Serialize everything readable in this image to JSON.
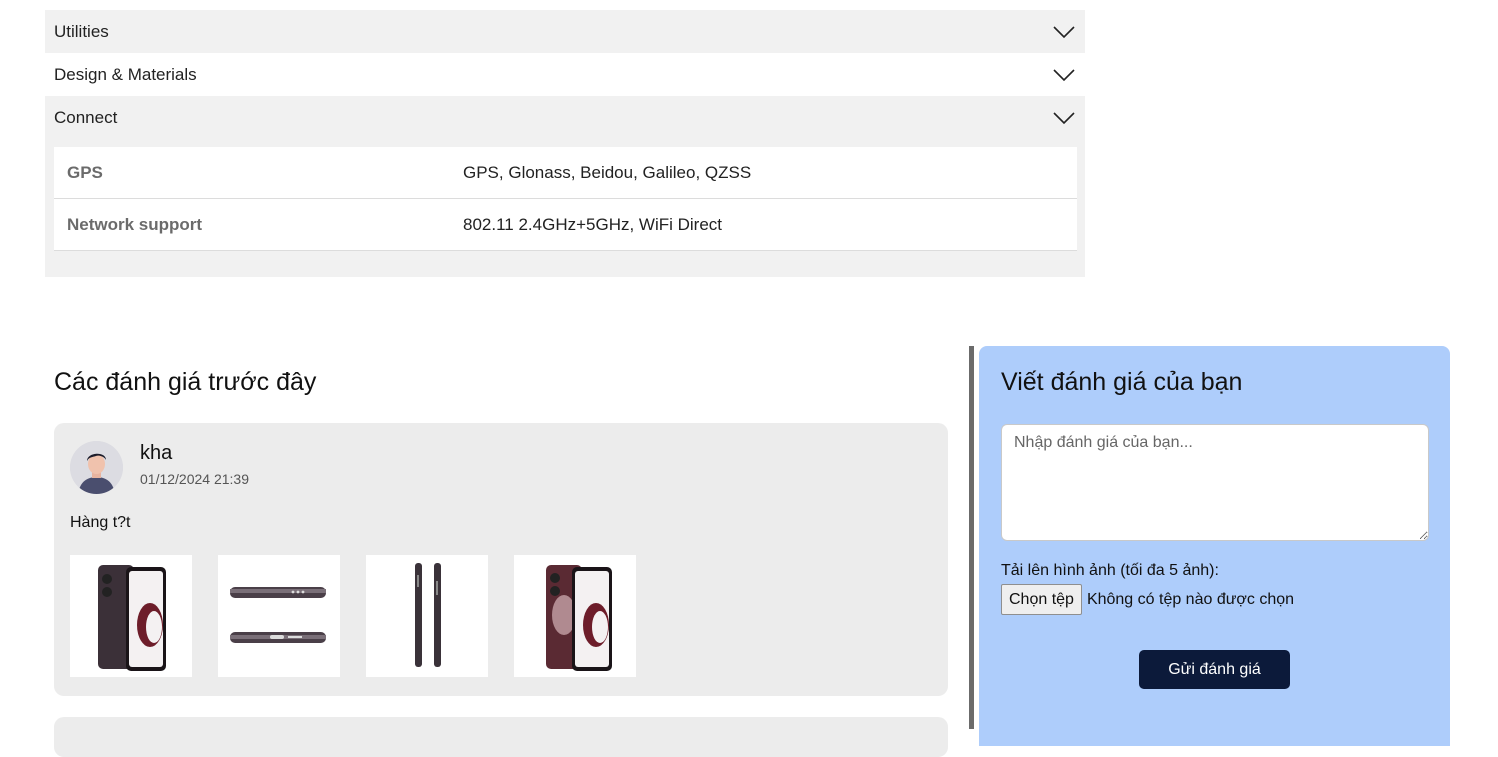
{
  "specs": {
    "sections": [
      {
        "label": "Utilities"
      },
      {
        "label": "Design & Materials"
      },
      {
        "label": "Connect"
      }
    ],
    "connect_rows": [
      {
        "key": "GPS",
        "value": "GPS, Glonass, Beidou, Galileo, QZSS"
      },
      {
        "key": "Network support",
        "value": "802.11 2.4GHz+5GHz, WiFi Direct"
      }
    ],
    "expand_icon": "chevron-down-icon"
  },
  "reviews": {
    "title": "Các đánh giá trước đây",
    "items": [
      {
        "name": "kha",
        "date": "01/12/2024 21:39",
        "text": "Hàng t?t",
        "image_count": 4
      }
    ]
  },
  "write_review": {
    "title": "Viết đánh giá của bạn",
    "placeholder": "Nhập đánh giá của bạn...",
    "upload_label": "Tải lên hình ảnh (tối đa 5 ảnh):",
    "file_button": "Chọn tệp",
    "file_status": "Không có tệp nào được chọn",
    "submit_label": "Gửi đánh giá"
  },
  "colors": {
    "accordion_bg": "#f1f1f1",
    "panel_bg": "#aecdfb",
    "submit_bg": "#0c1a3a",
    "card_bg": "#ececec"
  }
}
